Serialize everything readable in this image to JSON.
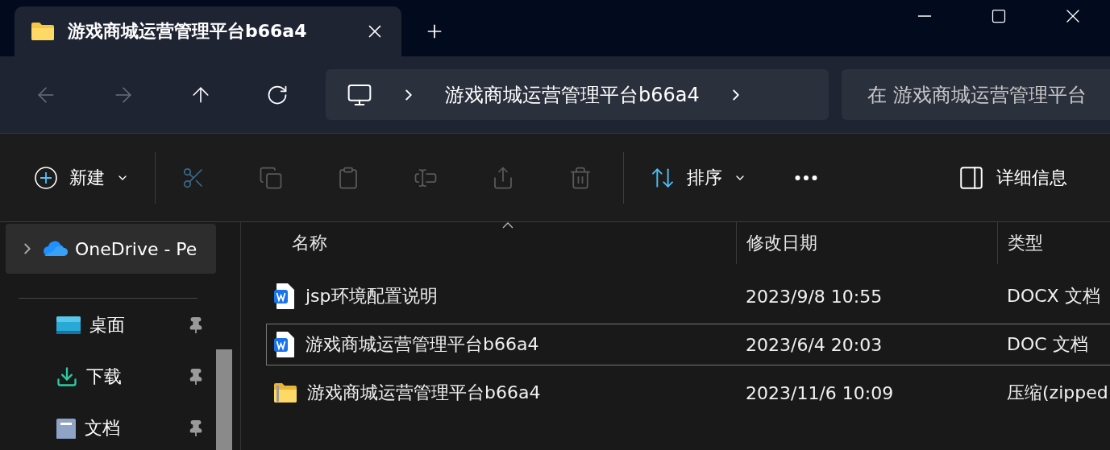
{
  "tabs": [
    {
      "label": "游戏商城运营管理平台b66a4",
      "selected": true
    }
  ],
  "address": {
    "segments": [
      "游戏商城运营管理平台b66a4"
    ]
  },
  "search": {
    "placeholder": "在 游戏商城运营管理平台"
  },
  "toolbar": {
    "new_label": "新建",
    "sort_label": "排序",
    "details_label": "详细信息",
    "actions": [
      {
        "kind": "cut",
        "disabled": true
      },
      {
        "kind": "copy",
        "disabled": true
      },
      {
        "kind": "paste",
        "disabled": true
      },
      {
        "kind": "rename",
        "disabled": true
      },
      {
        "kind": "share",
        "disabled": true
      },
      {
        "kind": "delete",
        "disabled": true
      }
    ]
  },
  "sidebar": {
    "items": [
      {
        "label": "OneDrive - Pe",
        "kind": "cloud",
        "selected": true,
        "pinned": false
      },
      {
        "label": "桌面",
        "kind": "desktop",
        "selected": false,
        "pinned": true
      },
      {
        "label": "下载",
        "kind": "download",
        "selected": false,
        "pinned": true
      },
      {
        "label": "文档",
        "kind": "documents",
        "selected": false,
        "pinned": true
      }
    ]
  },
  "table": {
    "columns": [
      "名称",
      "修改日期",
      "类型"
    ],
    "rows": [
      {
        "name": "jsp环境配置说明",
        "modified": "2023/9/8 10:55",
        "type": "DOCX 文档",
        "kind": "word",
        "selected": false
      },
      {
        "name": "游戏商城运营管理平台b66a4",
        "modified": "2023/6/4 20:03",
        "type": "DOC 文档",
        "kind": "word",
        "selected": true
      },
      {
        "name": "游戏商城运营管理平台b66a4",
        "modified": "2023/11/6 10:09",
        "type": "压缩(zipped",
        "kind": "zip",
        "selected": false
      }
    ]
  }
}
